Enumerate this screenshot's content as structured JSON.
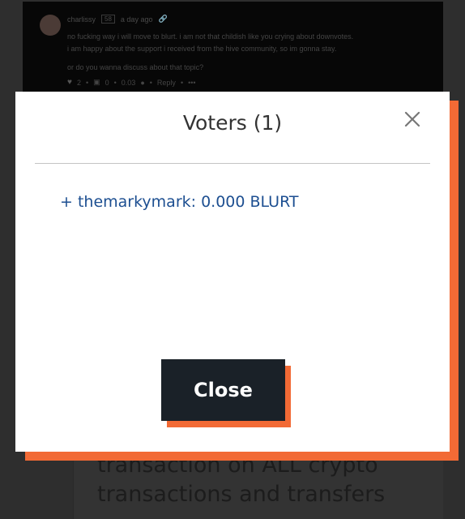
{
  "background": {
    "comment": {
      "author": "charlissy",
      "reputation": "58",
      "time": "a day ago",
      "lines": [
        "no fucking way i will move to blurt. i am not that childish like you crying about downvotes.",
        "i am happy about the support i received from the hive community, so im gonna stay.",
        "or do you wanna discuss about that topic?"
      ],
      "votes": "2",
      "gifts": "0",
      "payout": "0.03",
      "reply_label": "Reply",
      "more_label": "•••"
    },
    "post_text_lines": [
      "transaction on ALL crypto",
      "transactions and transfers"
    ]
  },
  "modal": {
    "title": "Voters (1)",
    "voters": [
      {
        "label": "+ themarkymark: 0.000 BLURT"
      }
    ],
    "close_button_label": "Close",
    "close_icon": "close-icon"
  },
  "colors": {
    "accent": "#f26a35",
    "button_bg": "#1a2128",
    "link": "#1d4f91",
    "title": "#333333"
  }
}
